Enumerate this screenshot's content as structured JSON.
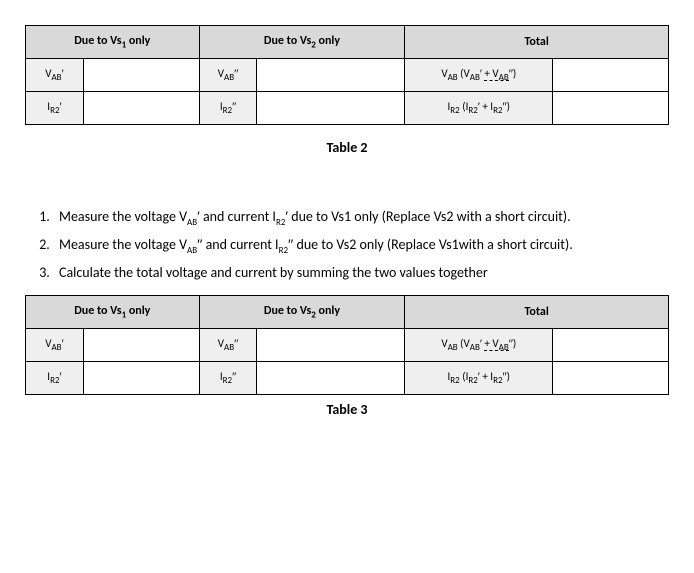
{
  "table2": {
    "headers": [
      "Due to Vs₁ only",
      "Due to Vs₂ only",
      "Total"
    ],
    "row1": {
      "c1": "VAB′",
      "c3": "VAB′′",
      "c5": "VAB (VAB′ + VAB′′)"
    },
    "row2": {
      "c1": "IR2′",
      "c3": "IR2′′",
      "c5": "IR2 (IR2′ + IR2′′)"
    },
    "caption": "Table 2"
  },
  "instructions": {
    "item1": "Measure the voltage VAB′ and current IR2′ due to Vs1 only (Replace Vs2 with a short circuit).",
    "item2": "Measure the voltage VAB′′ and current IR2′′ due to Vs2 only (Replace Vs1 with a short circuit).",
    "item3": "Calculate the total voltage and current by summing the two values together"
  },
  "table3": {
    "headers": [
      "Due to Vs₁ only",
      "Due to Vs₂ only",
      "Total"
    ],
    "row1": {
      "c1": "VAB′",
      "c3": "VAB′′",
      "c5": "VAB (VAB′ + VAB′′)"
    },
    "row2": {
      "c1": "IR2′",
      "c3": "IR2′′",
      "c5": "IR2 (IR2′ + IR2′′)"
    },
    "caption": "Table 3"
  }
}
